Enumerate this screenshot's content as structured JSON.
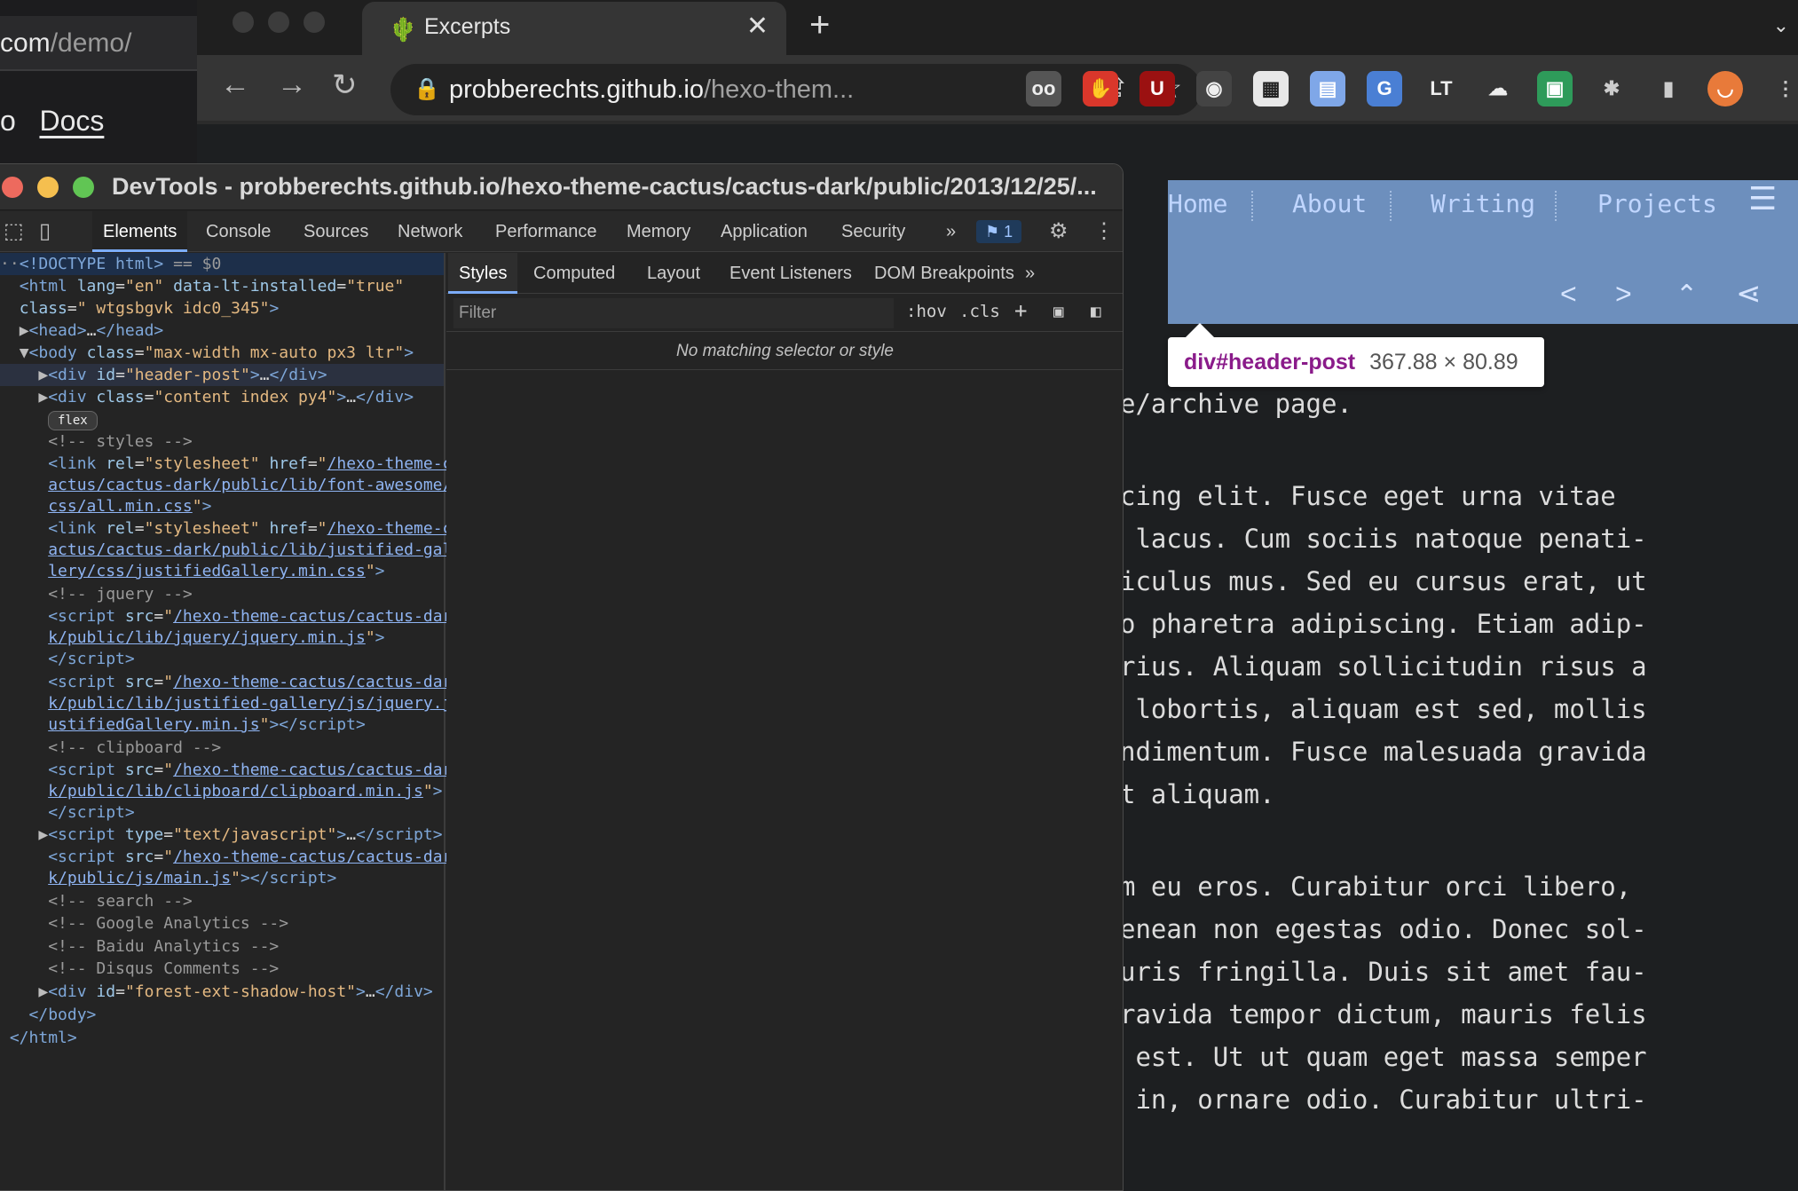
{
  "bg_window": {
    "url_host": "com",
    "url_path": "/demo/",
    "nav_fragment": "o",
    "docs_label": "Docs"
  },
  "browser": {
    "tab_title": "Excerpts",
    "url_host": "probberechts.github.io",
    "url_path": "/hexo-them..."
  },
  "extensions": [
    "reader-glasses-icon",
    "stop-hand-icon",
    "ublock-icon",
    "spy-glasses-icon",
    "qr-code-icon",
    "document-icon",
    "translate-icon",
    "latex-icon",
    "cloud-icon",
    "sheet-icon",
    "puzzle-icon",
    "sidebar-icon",
    "profile-avatar"
  ],
  "devtools": {
    "window_title": "DevTools - probberechts.github.io/hexo-theme-cactus/cactus-dark/public/2013/12/25/...",
    "tabs": [
      "Elements",
      "Console",
      "Sources",
      "Network",
      "Performance",
      "Memory",
      "Application",
      "Security"
    ],
    "more_tabs": "»",
    "issues_count": "1",
    "sub_tabs": [
      "Styles",
      "Computed",
      "Layout",
      "Event Listeners",
      "DOM Breakpoints"
    ],
    "filter_placeholder": "Filter",
    "hov_label": ":hov",
    "cls_label": ".cls",
    "no_match_text": "No matching selector or style",
    "flex_badge": "flex"
  },
  "site": {
    "nav": [
      "Home",
      "About",
      "Writing",
      "Projects"
    ],
    "tooltip_selector": "div#header-post",
    "tooltip_dims": "367.88 × 80.89",
    "body_lines": [
      "e/archive page.",
      "cing elit. Fusce eget urna vitae",
      " lacus. Cum sociis natoque penati-",
      "iculus mus. Sed eu cursus erat, ut",
      "o pharetra adipiscing. Etiam adip-",
      "rius. Aliquam sollicitudin risus a",
      " lobortis, aliquam est sed, mollis",
      "ndimentum. Fusce malesuada gravida",
      "t aliquam.",
      "m eu eros. Curabitur orci libero,",
      "enean non egestas odio. Donec sol-",
      "uris fringilla. Duis sit amet fau-",
      "ravida tempor dictum, mauris felis",
      " est. Ut ut quam eget massa semper",
      " in, ornare odio. Curabitur ultri-"
    ]
  }
}
